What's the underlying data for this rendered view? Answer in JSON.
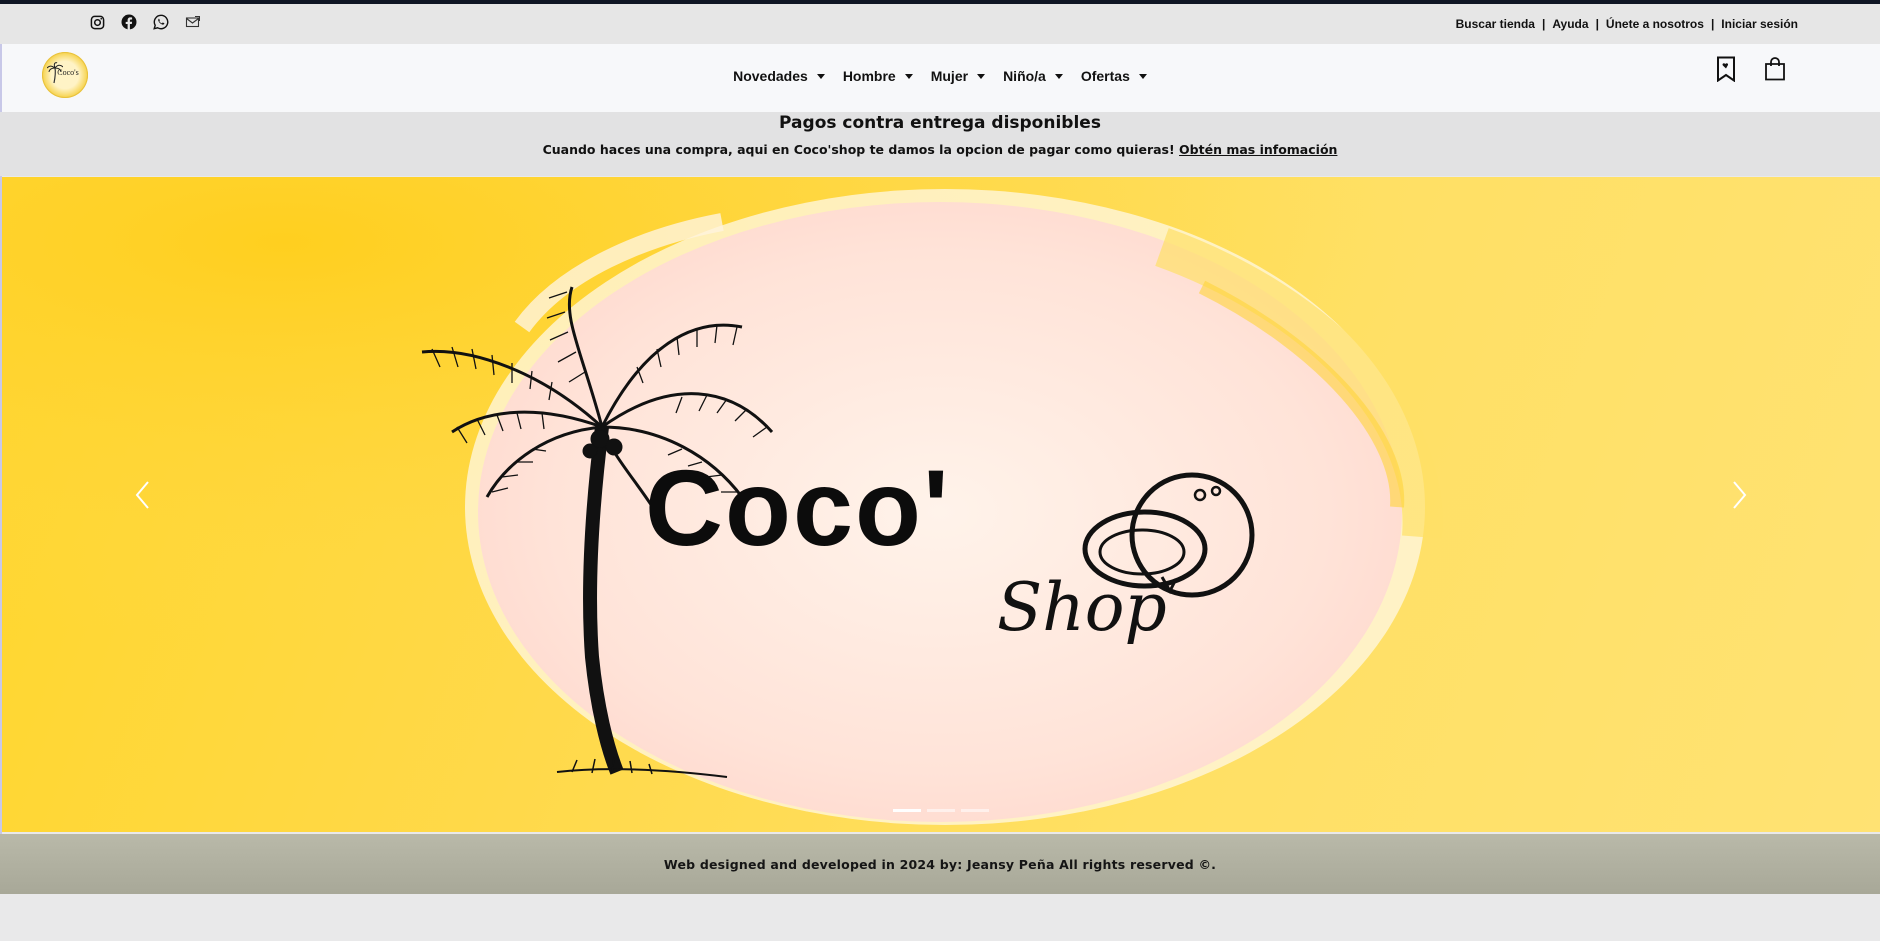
{
  "topbar": {
    "social_icons": [
      "instagram-icon",
      "facebook-icon",
      "whatsapp-icon",
      "mail-icon"
    ],
    "links": [
      "Buscar tienda",
      "Ayuda",
      "Únete a nosotros",
      "Iniciar sesión"
    ]
  },
  "navbar": {
    "logo_text": "Coco's",
    "menu": [
      "Novedades",
      "Hombre",
      "Mujer",
      "Niño/a",
      "Ofertas"
    ],
    "icons": [
      "bookmark-icon",
      "shopping-bag-icon"
    ]
  },
  "banner": {
    "title": "Pagos contra entrega disponibles",
    "text": "Cuando haces una compra, aqui en Coco'shop te damos la opcion de pagar como quieras!",
    "link": "Obtén mas infomación"
  },
  "hero": {
    "brand": "Coco'",
    "sub": "Shop",
    "slides_total": 3,
    "active_slide": 1
  },
  "footer": {
    "text": "Web designed and developed in 2024 by: Jeansy Peña All rights reserved ©."
  },
  "colors": {
    "hero_yellow": "#ffd62b",
    "hero_pink": "#ffdcd0",
    "footer": "#b0b0a0"
  }
}
